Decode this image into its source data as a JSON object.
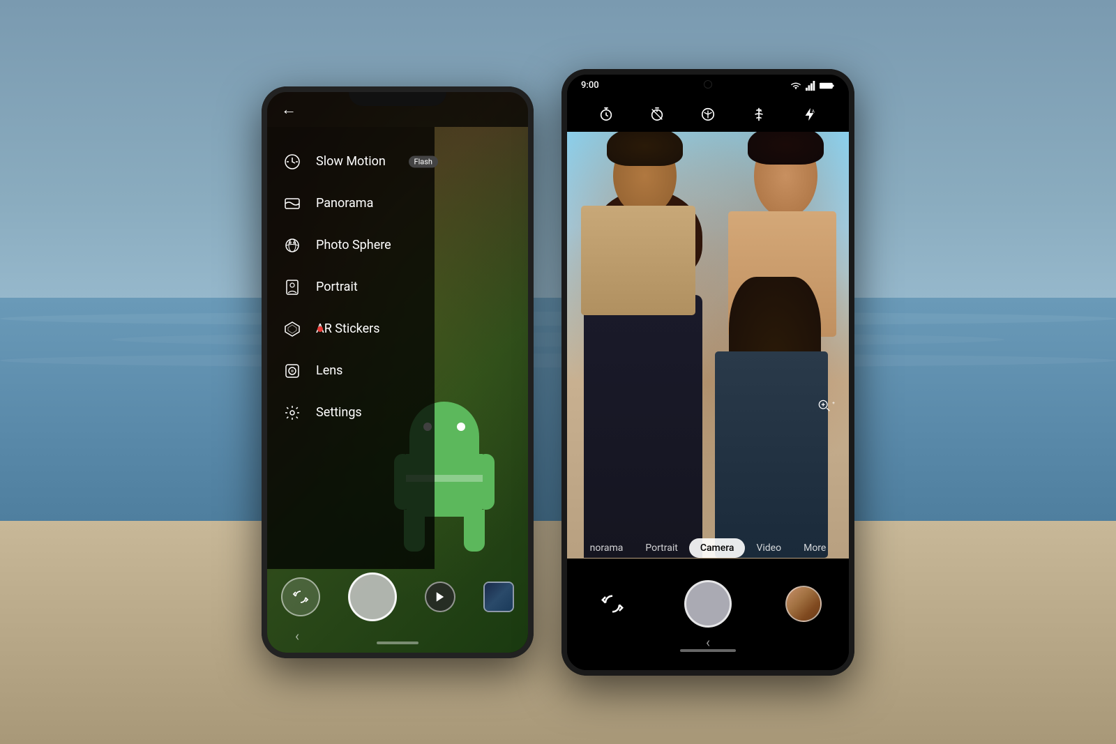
{
  "background": {
    "sky_color": "#7a9ab0",
    "sea_color": "#5a8aaa",
    "beach_color": "#b8a888"
  },
  "phone_left": {
    "menu": {
      "items": [
        {
          "id": "slow-motion",
          "label": "Slow Motion",
          "badge": "Flash",
          "has_badge": true
        },
        {
          "id": "panorama",
          "label": "Panorama",
          "has_badge": false
        },
        {
          "id": "photo-sphere",
          "label": "Photo Sphere",
          "has_badge": false
        },
        {
          "id": "portrait",
          "label": "Portrait",
          "has_badge": false
        },
        {
          "id": "ar-stickers",
          "label": "AR Stickers",
          "has_badge": false
        },
        {
          "id": "lens",
          "label": "Lens",
          "has_badge": false
        },
        {
          "id": "settings",
          "label": "Settings",
          "has_badge": false
        }
      ]
    },
    "bottom_controls": {
      "flip_label": "⟳",
      "video_label": "▶"
    }
  },
  "phone_right": {
    "status_bar": {
      "time": "9:00",
      "signal": "▲",
      "wifi": "▲",
      "battery": "■"
    },
    "mode_tabs": [
      {
        "id": "panorama",
        "label": "norama",
        "active": false
      },
      {
        "id": "portrait",
        "label": "Portrait",
        "active": false
      },
      {
        "id": "camera",
        "label": "Camera",
        "active": true
      },
      {
        "id": "video",
        "label": "Video",
        "active": false
      },
      {
        "id": "more",
        "label": "More",
        "active": false
      }
    ],
    "zoom": "⊕",
    "back_nav": "‹"
  }
}
